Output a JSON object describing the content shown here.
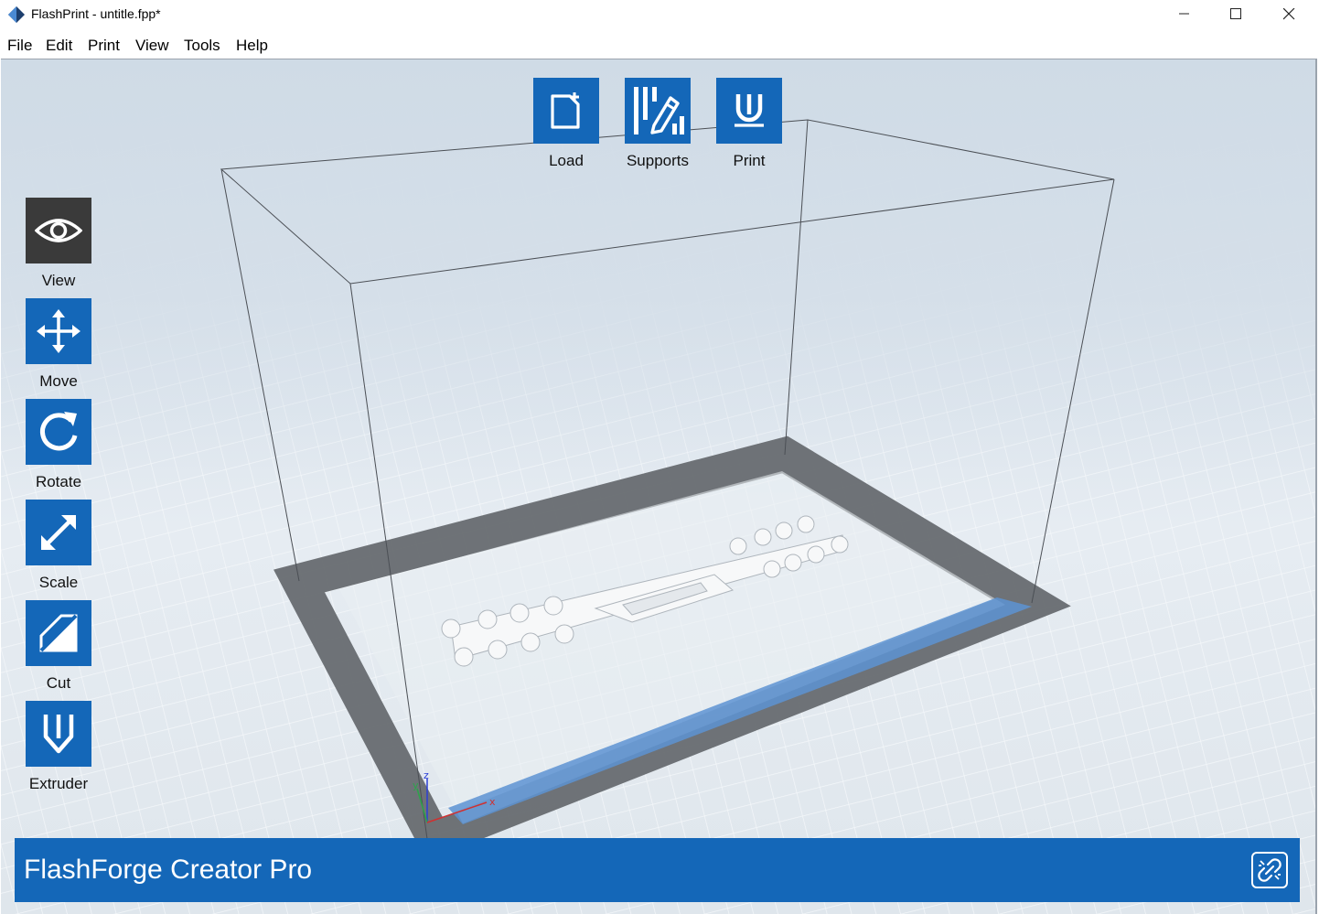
{
  "window": {
    "title": "FlashPrint - untitle.fpp*"
  },
  "menu": [
    "File",
    "Edit",
    "Print",
    "View",
    "Tools",
    "Help"
  ],
  "toolbar_top": [
    {
      "label": "Load",
      "icon": "load-file-icon"
    },
    {
      "label": "Supports",
      "icon": "supports-icon"
    },
    {
      "label": "Print",
      "icon": "print-nozzle-icon"
    }
  ],
  "toolbar_left": [
    {
      "label": "View",
      "icon": "eye-icon",
      "active": true
    },
    {
      "label": "Move",
      "icon": "move-arrows-icon"
    },
    {
      "label": "Rotate",
      "icon": "rotate-icon"
    },
    {
      "label": "Scale",
      "icon": "scale-arrow-icon"
    },
    {
      "label": "Cut",
      "icon": "cut-icon"
    },
    {
      "label": "Extruder",
      "icon": "extruder-icon"
    }
  ],
  "axes": {
    "x": "x",
    "y": "y",
    "z": "z"
  },
  "status": {
    "printer_name": "FlashForge Creator Pro",
    "connect_icon": "disconnected-link-icon"
  },
  "colors": {
    "accent": "#1467b8",
    "active_tool": "#3a3a3a",
    "platform_border": "#676b70",
    "front_highlight": "#5d93d2"
  }
}
